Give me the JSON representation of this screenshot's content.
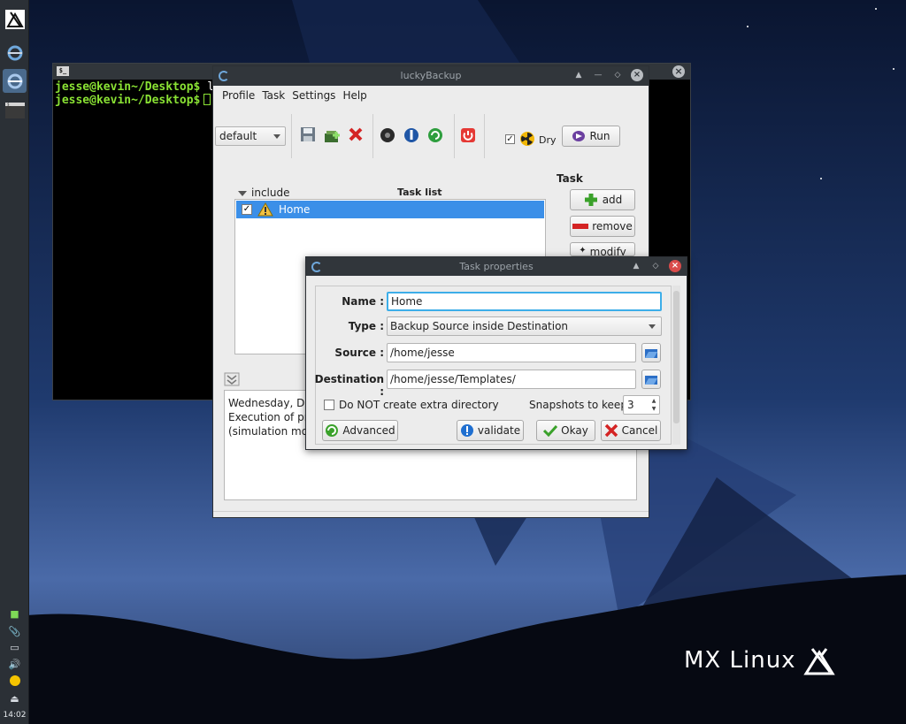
{
  "desktop": {
    "brand_text": "MX Linux",
    "clock": "14:02"
  },
  "terminal": {
    "lines": [
      {
        "prompt": "jesse@kevin~/Desktop$",
        "command": " ls"
      },
      {
        "prompt": "jesse@kevin~/Desktop$",
        "command": ""
      }
    ]
  },
  "lucky": {
    "title": "luckyBackup",
    "menu": [
      "Profile",
      "Task",
      "Settings",
      "Help"
    ],
    "profile": "default",
    "dry_label": "Dry",
    "run_label": "Run",
    "include_label": "include",
    "tasklist_label": "Task list",
    "task_section_label": "Task",
    "add_label": "add",
    "remove_label": "remove",
    "modify_label": "modify",
    "tasks": [
      {
        "name": "Home",
        "checked": true,
        "selected": true
      }
    ],
    "log_lines": [
      "Wednesday, Dec",
      "Execution of prof",
      "(simulation mode"
    ]
  },
  "dialog": {
    "title": "Task properties",
    "name_label": "Name :",
    "name_value": "Home",
    "type_label": "Type :",
    "type_value": "Backup Source inside Destination",
    "source_label": "Source :",
    "source_value": "/home/jesse",
    "destination_label": "Destination :",
    "destination_value": "/home/jesse/Templates/",
    "no_extra_dir_label": "Do NOT create extra directory",
    "snapshots_label": "Snapshots to keep:",
    "snapshots_value": "3",
    "advanced_label": "Advanced",
    "validate_label": "validate",
    "okay_label": "Okay",
    "cancel_label": "Cancel"
  },
  "colors": {
    "selection": "#3b8fe8",
    "focus": "#3daee9",
    "prompt": "#8ae234"
  }
}
